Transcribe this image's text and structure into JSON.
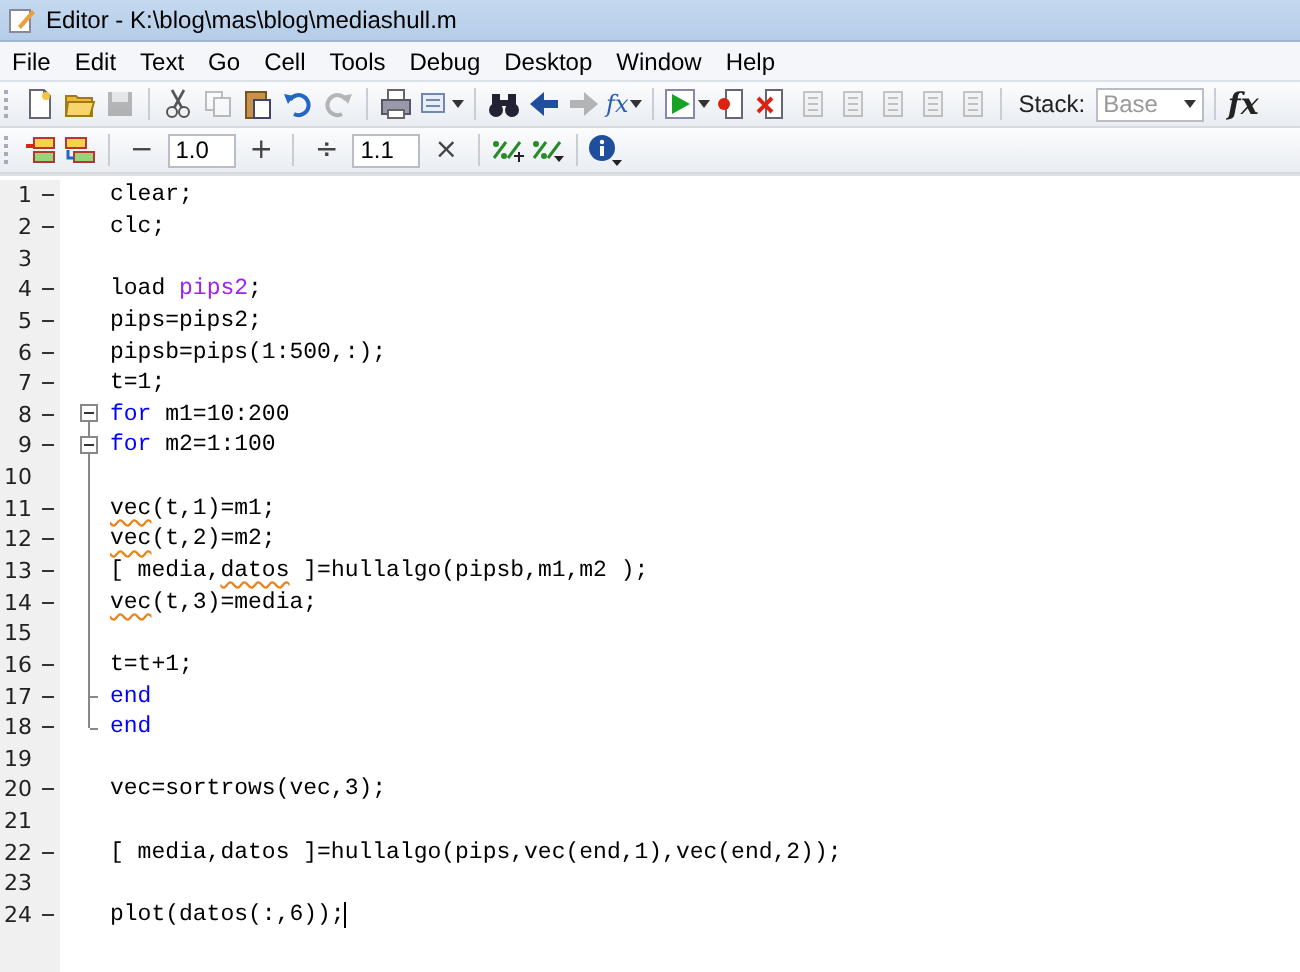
{
  "window": {
    "title": "Editor - K:\\blog\\mas\\blog\\mediashull.m"
  },
  "menu": [
    "File",
    "Edit",
    "Text",
    "Go",
    "Cell",
    "Tools",
    "Debug",
    "Desktop",
    "Window",
    "Help"
  ],
  "toolbar": {
    "groups": [
      [
        {
          "kind": "new",
          "disabled": false
        },
        {
          "kind": "open",
          "disabled": false
        },
        {
          "kind": "save",
          "disabled": true
        }
      ],
      [
        {
          "kind": "cut",
          "disabled": false
        },
        {
          "kind": "copy",
          "disabled": true
        },
        {
          "kind": "paste",
          "disabled": false
        },
        {
          "kind": "undo",
          "disabled": false
        },
        {
          "kind": "redo",
          "disabled": true
        }
      ],
      [
        {
          "kind": "print",
          "disabled": false
        },
        {
          "kind": "publish",
          "disabled": false,
          "dropdown": true
        }
      ],
      [
        {
          "kind": "find",
          "disabled": false
        },
        {
          "kind": "back",
          "disabled": false
        },
        {
          "kind": "forward",
          "disabled": true
        },
        {
          "kind": "fx",
          "disabled": false,
          "dropdown": true,
          "text": "fx"
        }
      ],
      [
        {
          "kind": "run",
          "disabled": false,
          "dropdown": true
        },
        {
          "kind": "breakpoint",
          "disabled": false
        },
        {
          "kind": "clearbreak",
          "disabled": false
        },
        {
          "kind": "step",
          "disabled": true
        },
        {
          "kind": "stepin",
          "disabled": true
        },
        {
          "kind": "stepout",
          "disabled": true
        },
        {
          "kind": "continue",
          "disabled": true
        },
        {
          "kind": "exit",
          "disabled": true
        }
      ]
    ],
    "stack_label": "Stack:",
    "stack_value": "Base",
    "stack_disabled": true,
    "function_button": "fx"
  },
  "cell_toolbar": {
    "minus": "−",
    "first_value": "1.0",
    "plus": "+",
    "divide": "÷",
    "second_value": "1.1",
    "times": "×"
  },
  "editor": {
    "lines": [
      {
        "number": "1",
        "executable": true,
        "segments": [
          {
            "kind": "plain",
            "text": "clear;"
          }
        ]
      },
      {
        "number": "2",
        "executable": true,
        "segments": [
          {
            "kind": "plain",
            "text": "clc;"
          }
        ]
      },
      {
        "number": "3",
        "executable": false
      },
      {
        "number": "4",
        "executable": true,
        "segments": [
          {
            "kind": "plain",
            "text": "load "
          },
          {
            "kind": "string",
            "text": "pips2"
          },
          {
            "kind": "plain",
            "text": ";"
          }
        ]
      },
      {
        "number": "5",
        "executable": true,
        "segments": [
          {
            "kind": "plain",
            "text": "pips=pips2;"
          }
        ]
      },
      {
        "number": "6",
        "executable": true,
        "segments": [
          {
            "kind": "plain",
            "text": "pipsb=pips(1:500,:);"
          }
        ]
      },
      {
        "number": "7",
        "executable": true,
        "segments": [
          {
            "kind": "plain",
            "text": "t=1;"
          }
        ]
      },
      {
        "number": "8",
        "executable": true,
        "fold_toggle": true,
        "segments": [
          {
            "kind": "keyword",
            "text": "for"
          },
          {
            "kind": "plain",
            "text": " m1=10:200"
          }
        ]
      },
      {
        "number": "9",
        "executable": true,
        "fold_toggle": true,
        "segments": [
          {
            "kind": "keyword",
            "text": "for"
          },
          {
            "kind": "plain",
            "text": " m2=1:100"
          }
        ]
      },
      {
        "number": "10",
        "executable": false
      },
      {
        "number": "11",
        "executable": true,
        "segments": [
          {
            "kind": "warning",
            "text": "vec"
          },
          {
            "kind": "plain",
            "text": "(t,1)=m1;"
          }
        ]
      },
      {
        "number": "12",
        "executable": true,
        "segments": [
          {
            "kind": "warning",
            "text": "vec"
          },
          {
            "kind": "plain",
            "text": "(t,2)=m2;"
          }
        ]
      },
      {
        "number": "13",
        "executable": true,
        "segments": [
          {
            "kind": "plain",
            "text": "[ media,"
          },
          {
            "kind": "warning",
            "text": "datos"
          },
          {
            "kind": "plain",
            "text": " ]=hullalgo(pipsb,m1,m2 );"
          }
        ]
      },
      {
        "number": "14",
        "executable": true,
        "segments": [
          {
            "kind": "warning",
            "text": "vec"
          },
          {
            "kind": "plain",
            "text": "(t,3)=media;"
          }
        ]
      },
      {
        "number": "15",
        "executable": false
      },
      {
        "number": "16",
        "executable": true,
        "segments": [
          {
            "kind": "plain",
            "text": "t=t+1;"
          }
        ]
      },
      {
        "number": "17",
        "executable": true,
        "fold_end": true,
        "segments": [
          {
            "kind": "keyword",
            "text": "end"
          }
        ]
      },
      {
        "number": "18",
        "executable": true,
        "fold_end": true,
        "segments": [
          {
            "kind": "keyword",
            "text": "end"
          }
        ]
      },
      {
        "number": "19",
        "executable": false
      },
      {
        "number": "20",
        "executable": true,
        "segments": [
          {
            "kind": "plain",
            "text": "vec=sortrows(vec,3);"
          }
        ]
      },
      {
        "number": "21",
        "executable": false
      },
      {
        "number": "22",
        "executable": true,
        "segments": [
          {
            "kind": "plain",
            "text": "[ media,datos ]=hullalgo(pips,vec(end,1),vec(end,2));"
          }
        ]
      },
      {
        "number": "23",
        "executable": false
      },
      {
        "number": "24",
        "executable": true,
        "cursor": true,
        "segments": [
          {
            "kind": "plain",
            "text": "plot(datos(:,6));"
          }
        ]
      }
    ]
  }
}
